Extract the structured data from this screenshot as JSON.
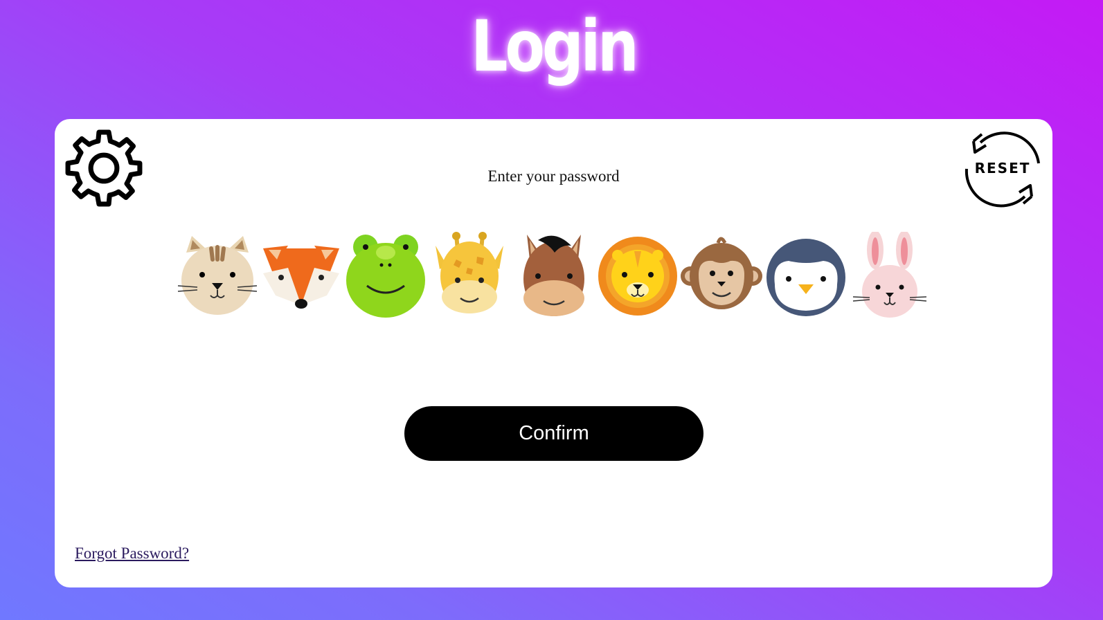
{
  "page": {
    "title": "Login"
  },
  "card": {
    "prompt": "Enter your password",
    "settings_icon": "gear-icon",
    "reset_icon": "reset-icon",
    "reset_label": "RESET",
    "animals": [
      {
        "name": "cat",
        "icon": "cat-icon"
      },
      {
        "name": "fox",
        "icon": "fox-icon"
      },
      {
        "name": "frog",
        "icon": "frog-icon"
      },
      {
        "name": "giraffe",
        "icon": "giraffe-icon"
      },
      {
        "name": "horse",
        "icon": "horse-icon"
      },
      {
        "name": "lion",
        "icon": "lion-icon"
      },
      {
        "name": "monkey",
        "icon": "monkey-icon"
      },
      {
        "name": "penguin",
        "icon": "penguin-icon"
      },
      {
        "name": "rabbit",
        "icon": "rabbit-icon"
      }
    ],
    "confirm_label": "Confirm",
    "forgot_label": "Forgot Password?"
  },
  "colors": {
    "background_start": "#7078ff",
    "background_end": "#c41af5",
    "button": "#000000",
    "card": "#ffffff"
  }
}
